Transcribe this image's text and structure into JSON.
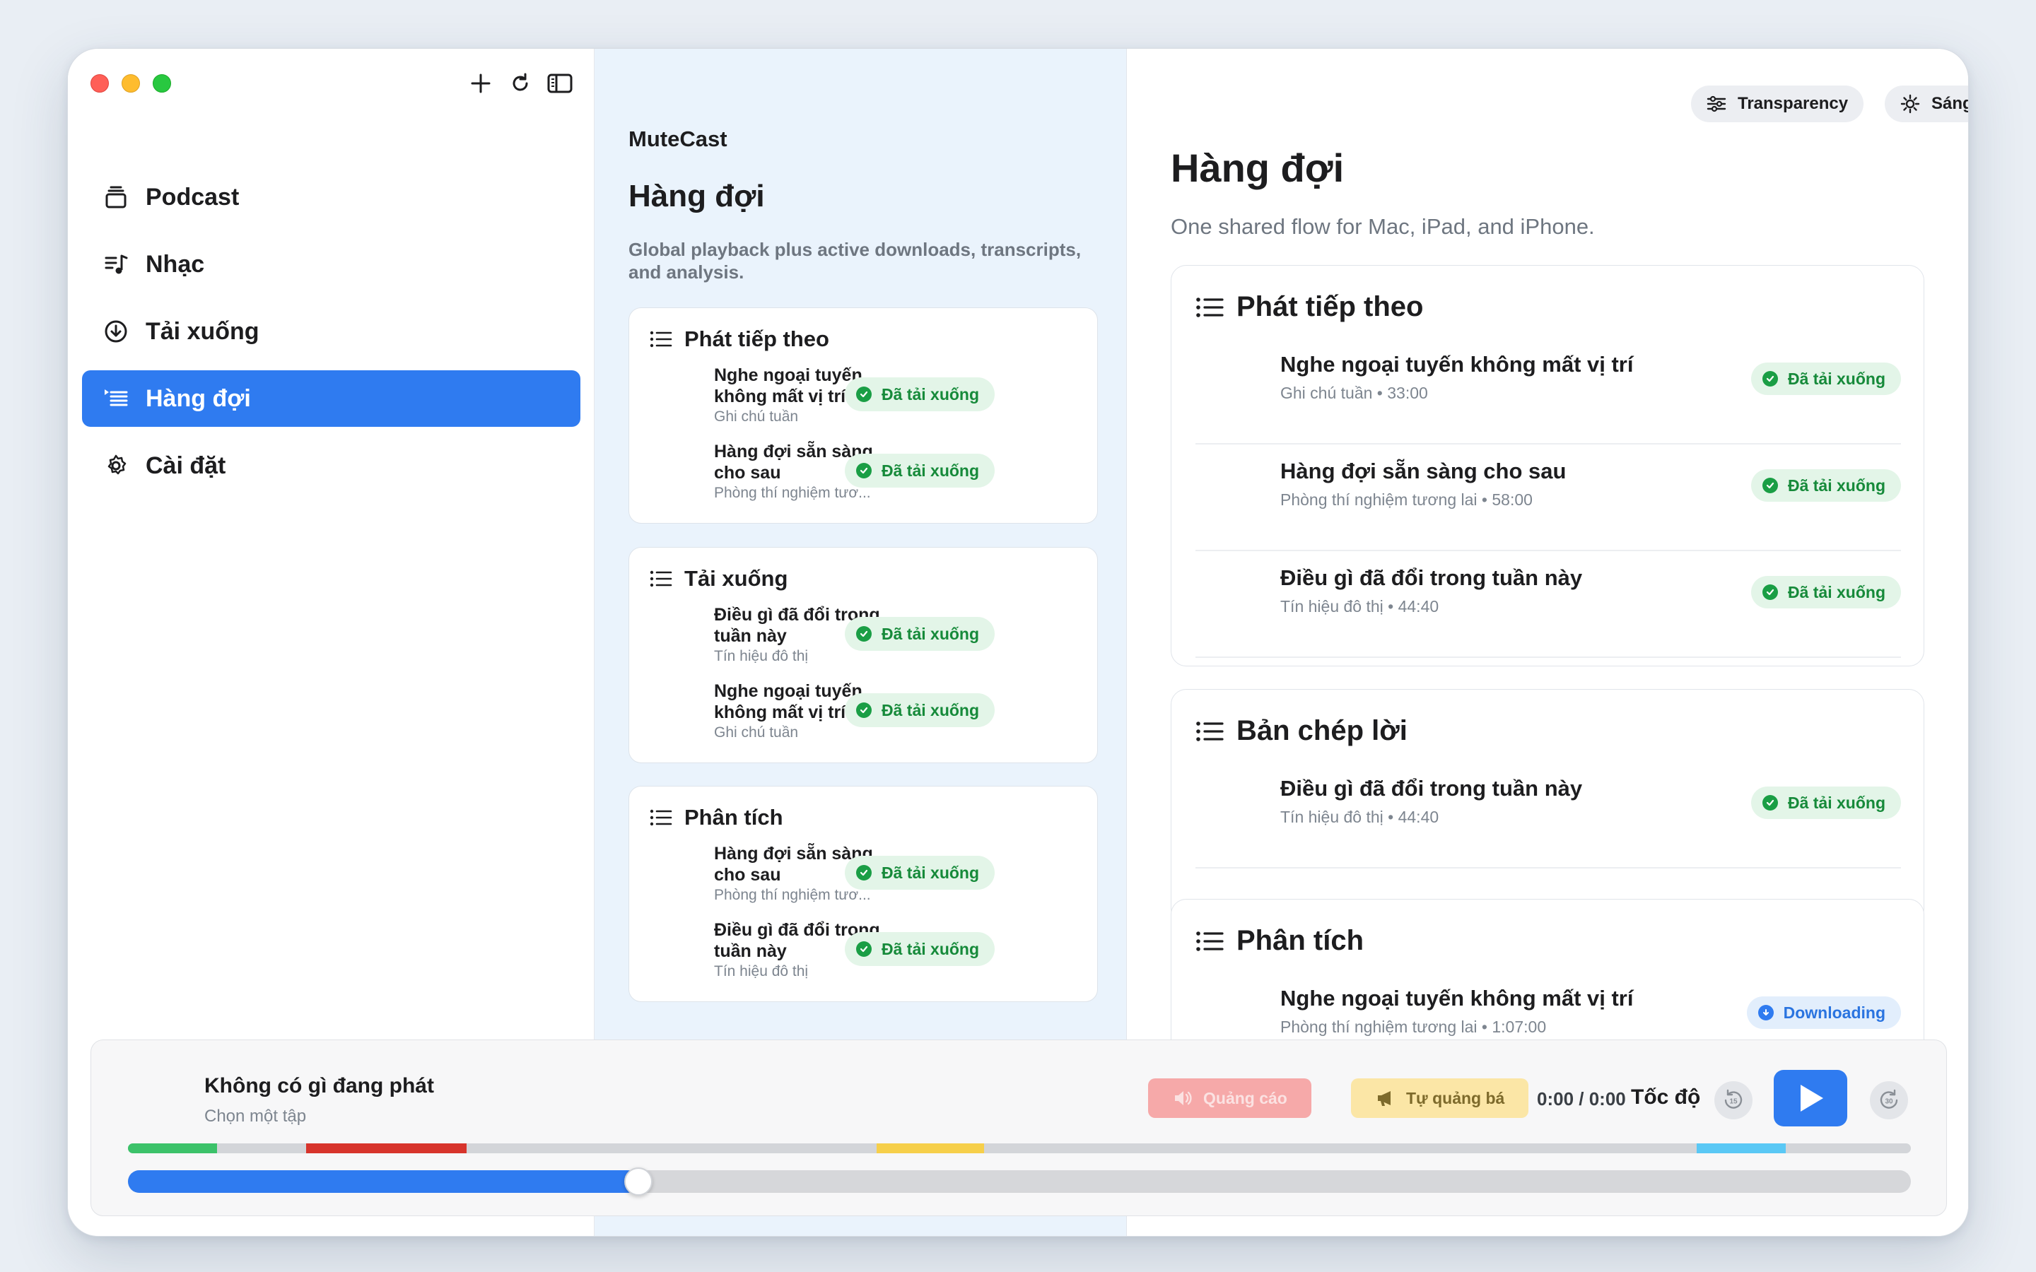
{
  "sidebar": {
    "items": [
      {
        "label": "Podcast",
        "icon": "podcast-icon"
      },
      {
        "label": "Nhạc",
        "icon": "music-icon"
      },
      {
        "label": "Tải xuống",
        "icon": "download-icon"
      },
      {
        "label": "Hàng đợi",
        "icon": "queue-icon",
        "active": true
      },
      {
        "label": "Cài đặt",
        "icon": "gear-icon"
      }
    ]
  },
  "middle": {
    "app_name": "MuteCast",
    "title": "Hàng đợi",
    "subtitle": "Global playback plus active downloads, transcripts, and analysis.",
    "cards": [
      {
        "title": "Phát tiếp theo",
        "rows": [
          {
            "title": "Nghe ngoại tuyến không mất vị trí",
            "subtitle": "Ghi chú tuần",
            "badge": "Đã tải xuống"
          },
          {
            "title": "Hàng đợi sẵn sàng cho sau",
            "subtitle": "Phòng thí nghiệm tươ...",
            "badge": "Đã tải xuống"
          }
        ]
      },
      {
        "title": "Tải xuống",
        "rows": [
          {
            "title": "Điều gì đã đổi trong tuần này",
            "subtitle": "Tín hiệu đô thị",
            "badge": "Đã tải xuống"
          },
          {
            "title": "Nghe ngoại tuyến không mất vị trí",
            "subtitle": "Ghi chú tuần",
            "badge": "Đã tải xuống"
          }
        ]
      },
      {
        "title": "Phân tích",
        "rows": [
          {
            "title": "Hàng đợi sẵn sàng cho sau",
            "subtitle": "Phòng thí nghiệm tươ...",
            "badge": "Đã tải xuống"
          },
          {
            "title": "Điều gì đã đổi trong tuần này",
            "subtitle": "Tín hiệu đô thị",
            "badge": "Đã tải xuống"
          }
        ]
      }
    ]
  },
  "right": {
    "transparency_label": "Transparency",
    "theme_label": "Sáng",
    "title": "Hàng đợi",
    "subtitle": "One shared flow for Mac, iPad, and iPhone.",
    "cards": [
      {
        "title": "Phát tiếp theo",
        "rows": [
          {
            "title": "Nghe ngoại tuyến không mất vị trí",
            "subtitle": "Ghi chú tuần • 33:00",
            "badge": "Đã tải xuống",
            "status": "downloaded"
          },
          {
            "title": "Hàng đợi sẵn sàng cho sau",
            "subtitle": "Phòng thí nghiệm tương lai • 58:00",
            "badge": "Đã tải xuống",
            "status": "downloaded"
          },
          {
            "title": "Điều gì đã đổi trong tuần này",
            "subtitle": "Tín hiệu đô thị • 44:40",
            "badge": "Đã tải xuống",
            "status": "downloaded"
          }
        ]
      },
      {
        "title": "Bản chép lời",
        "rows": [
          {
            "title": "Điều gì đã đổi trong tuần này",
            "subtitle": "Tín hiệu đô thị • 44:40",
            "badge": "Đã tải xuống",
            "status": "downloaded"
          }
        ]
      },
      {
        "title": "Phân tích",
        "rows": [
          {
            "title": "Nghe ngoại tuyến không mất vị trí",
            "subtitle": "Phòng thí nghiệm tương lai • 1:07:00",
            "badge": "Downloading",
            "status": "downloading"
          }
        ]
      }
    ]
  },
  "player": {
    "title": "Không có gì đang phát",
    "subtitle": "Chọn một tập",
    "ad_label": "Quảng cáo",
    "promo_label": "Tự quảng bá",
    "time": "0:00 / 0:00",
    "speed_label": "Tốc độ",
    "skip_back_label": "15",
    "skip_forward_label": "30",
    "progress_fraction": 0.28,
    "segments": [
      {
        "start": 0.0,
        "end": 0.05,
        "color": "#3cc26a"
      },
      {
        "start": 0.1,
        "end": 0.19,
        "color": "#d7342c"
      },
      {
        "start": 0.42,
        "end": 0.48,
        "color": "#f6cf4a"
      },
      {
        "start": 0.88,
        "end": 0.93,
        "color": "#5ac8f5"
      }
    ]
  },
  "colors": {
    "accent": "#2f7bf0",
    "success": "#1a9e45",
    "success_bg": "#e3f5e8"
  }
}
